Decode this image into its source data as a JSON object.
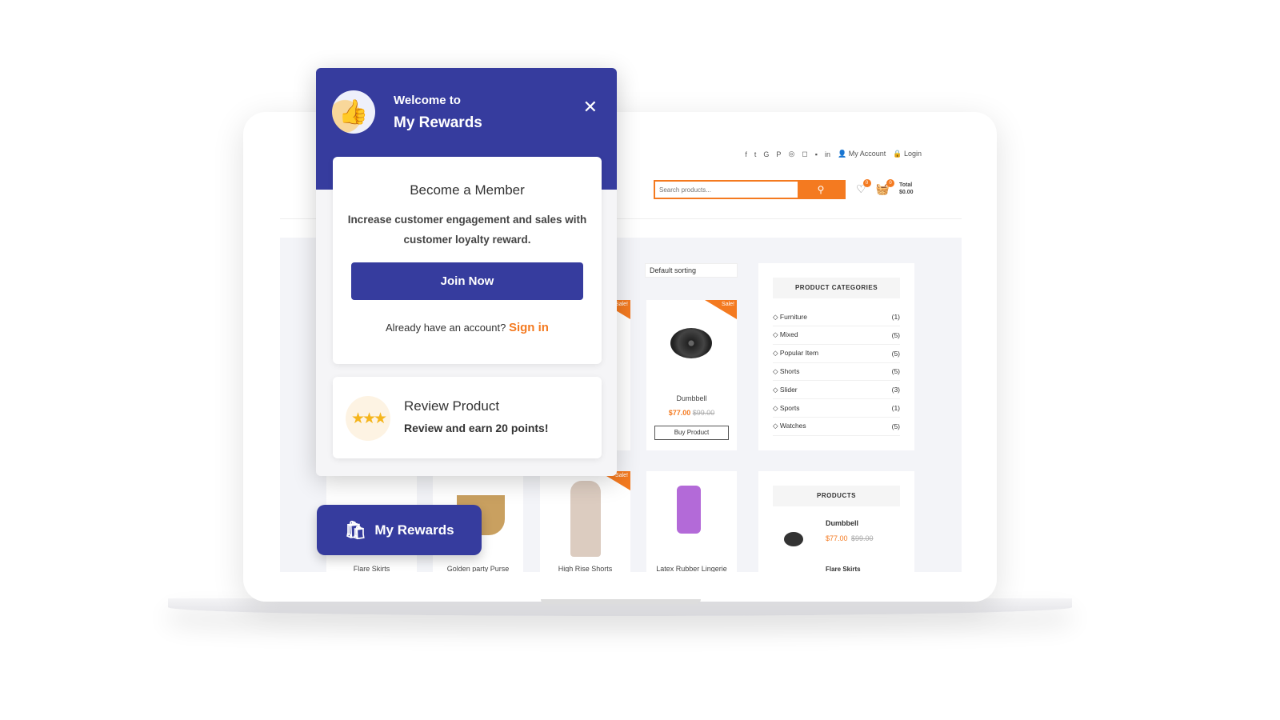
{
  "colors": {
    "brand": "#363c9e",
    "accent": "#f47a20"
  },
  "store": {
    "social_icons": [
      "facebook-icon",
      "twitter-icon",
      "google-plus-icon",
      "pinterest-icon",
      "dribbble-icon",
      "instagram-icon",
      "flickr-icon",
      "linkedin-icon"
    ],
    "social_glyphs": [
      "f",
      "t",
      "G",
      "P",
      "◎",
      "◻",
      "▪",
      "in"
    ],
    "my_account": "My Account",
    "login": "Login",
    "search_placeholder": "Search products...",
    "wishlist_count": "0",
    "cart_count": "0",
    "total_label": "Total",
    "total_value": "$0.00",
    "sorting": "Default sorting",
    "sale_label": "Sale!",
    "products": [
      {
        "name": "Dumbbell",
        "price": "$77.00",
        "old_price": "$99.00",
        "button": "Buy Product"
      },
      {
        "name": "Flare Skirts"
      },
      {
        "name": "Golden party Purse"
      },
      {
        "name": "High Rise Shorts"
      },
      {
        "name": "Latex Rubber Lingerie"
      }
    ],
    "categories_title": "PRODUCT CATEGORIES",
    "categories": [
      {
        "name": "Furniture",
        "count": "(1)"
      },
      {
        "name": "Mixed",
        "count": "(5)"
      },
      {
        "name": "Popular Item",
        "count": "(5)"
      },
      {
        "name": "Shorts",
        "count": "(5)"
      },
      {
        "name": "Slider",
        "count": "(3)"
      },
      {
        "name": "Sports",
        "count": "(1)"
      },
      {
        "name": "Watches",
        "count": "(5)"
      }
    ],
    "products_widget": {
      "title": "PRODUCTS",
      "items": [
        {
          "name": "Dumbbell",
          "price": "$77.00",
          "old_price": "$99.00"
        },
        {
          "name": "Flare Skirts"
        }
      ]
    }
  },
  "popup": {
    "welcome": "Welcome to",
    "title": "My Rewards",
    "member": {
      "heading": "Become a Member",
      "text": "Increase customer engagement and sales with customer loyalty reward.",
      "join": "Join Now",
      "already": "Already have an account?",
      "signin": "Sign in"
    },
    "review": {
      "heading": "Review Product",
      "text": "Review and earn 20 points!"
    }
  },
  "launcher": {
    "label": "My Rewards"
  }
}
